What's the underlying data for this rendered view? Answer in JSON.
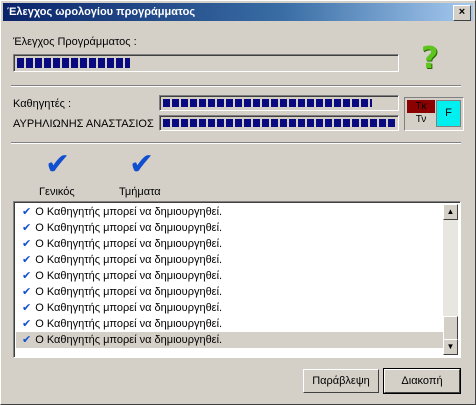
{
  "window": {
    "title": "Έλεγχος ωρολογίου προγράμματος",
    "close": "×"
  },
  "program_check": {
    "label": "Έλεγχος Προγράμματος :",
    "progress": 0.3
  },
  "help": {
    "glyph": "?"
  },
  "teachers": {
    "label": "Καθηγητές :",
    "progress": 0.9
  },
  "current_teacher": {
    "name": "ΑΥΡΗΛΙΩΝΗΣ ΑΝΑΣΤΑΣΙΟΣ",
    "progress": 1.0
  },
  "indicator": {
    "tk": "Τκ",
    "tv": "Τν",
    "f": "F"
  },
  "checks": [
    {
      "label": "Γενικός"
    },
    {
      "label": "Τμήματα"
    }
  ],
  "messages": [
    "Ο Καθηγητής μπορεί να δημιουργηθεί.",
    "Ο Καθηγητής μπορεί να δημιουργηθεί.",
    "Ο Καθηγητής μπορεί να δημιουργηθεί.",
    "Ο Καθηγητής μπορεί να δημιουργηθεί.",
    "Ο Καθηγητής μπορεί να δημιουργηθεί.",
    "Ο Καθηγητής μπορεί να δημιουργηθεί.",
    "Ο Καθηγητής μπορεί να δημιουργηθεί.",
    "Ο Καθηγητής μπορεί να δημιουργηθεί.",
    "Ο Καθηγητής μπορεί να δημιουργηθεί."
  ],
  "buttons": {
    "skip": "Παράβλεψη",
    "stop": "Διακοπή"
  },
  "colors": {
    "progress_fill": "#0a0a80",
    "check": "#1050d0",
    "help": "#5ec51f",
    "tk_bg": "#8b0000",
    "f_bg": "#00f0f0"
  }
}
